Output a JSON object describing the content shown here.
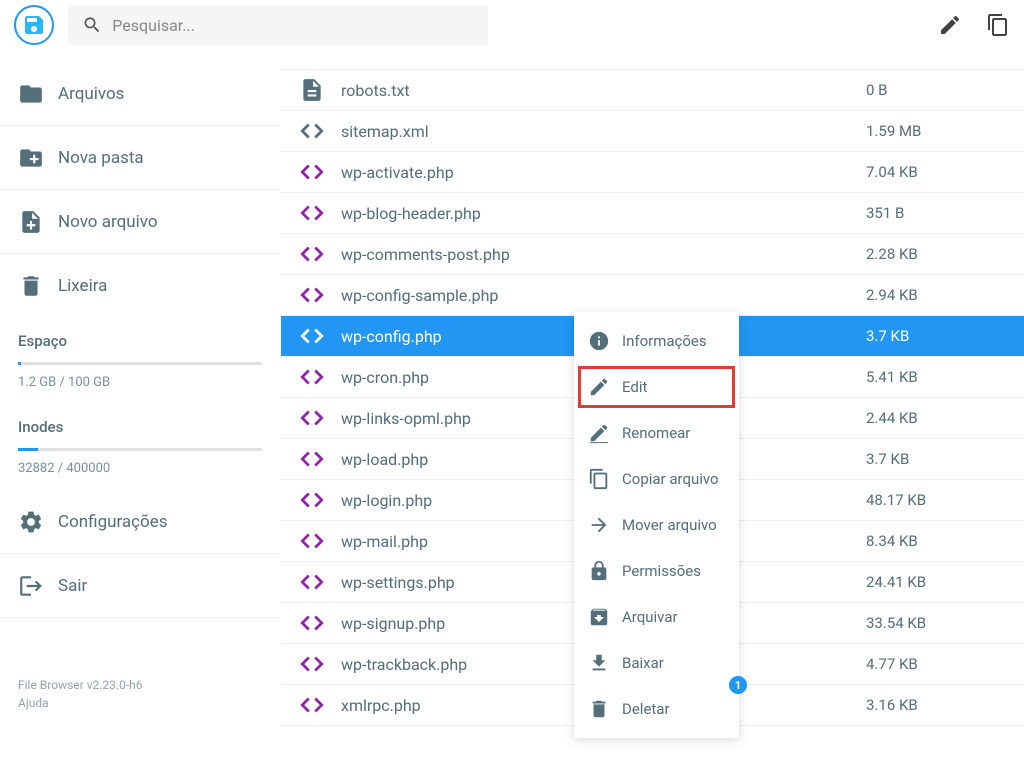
{
  "header": {
    "search_placeholder": "Pesquisar..."
  },
  "sidebar": {
    "nav": [
      {
        "label": "Arquivos",
        "icon": "folder"
      },
      {
        "label": "Nova pasta",
        "icon": "create-folder"
      },
      {
        "label": "Novo arquivo",
        "icon": "note-add"
      },
      {
        "label": "Lixeira",
        "icon": "trash"
      }
    ],
    "meters": [
      {
        "label": "Espaço",
        "text": "1.2 GB / 100 GB",
        "fill_pct": 1.2
      },
      {
        "label": "Inodes",
        "text": "32882 / 400000",
        "fill_pct": 8
      }
    ],
    "bottom_nav": [
      {
        "label": "Configurações",
        "icon": "settings"
      },
      {
        "label": "Sair",
        "icon": "logout"
      }
    ],
    "version": "File Browser v2.23.0-h6",
    "help": "Ajuda"
  },
  "files": [
    {
      "name": "robots.txt",
      "size": "0 B",
      "icon": "doc",
      "selected": false
    },
    {
      "name": "sitemap.xml",
      "size": "1.59 MB",
      "icon": "code-gray",
      "selected": false
    },
    {
      "name": "wp-activate.php",
      "size": "7.04 KB",
      "icon": "code",
      "selected": false
    },
    {
      "name": "wp-blog-header.php",
      "size": "351 B",
      "icon": "code",
      "selected": false
    },
    {
      "name": "wp-comments-post.php",
      "size": "2.28 KB",
      "icon": "code",
      "selected": false
    },
    {
      "name": "wp-config-sample.php",
      "size": "2.94 KB",
      "icon": "code",
      "selected": false
    },
    {
      "name": "wp-config.php",
      "size": "3.7 KB",
      "icon": "code",
      "selected": true
    },
    {
      "name": "wp-cron.php",
      "size": "5.41 KB",
      "icon": "code",
      "selected": false
    },
    {
      "name": "wp-links-opml.php",
      "size": "2.44 KB",
      "icon": "code",
      "selected": false
    },
    {
      "name": "wp-load.php",
      "size": "3.7 KB",
      "icon": "code",
      "selected": false
    },
    {
      "name": "wp-login.php",
      "size": "48.17 KB",
      "icon": "code",
      "selected": false
    },
    {
      "name": "wp-mail.php",
      "size": "8.34 KB",
      "icon": "code",
      "selected": false
    },
    {
      "name": "wp-settings.php",
      "size": "24.41 KB",
      "icon": "code",
      "selected": false
    },
    {
      "name": "wp-signup.php",
      "size": "33.54 KB",
      "icon": "code",
      "selected": false
    },
    {
      "name": "wp-trackback.php",
      "size": "4.77 KB",
      "icon": "code",
      "selected": false
    },
    {
      "name": "xmlrpc.php",
      "size": "3.16 KB",
      "icon": "code",
      "selected": false
    }
  ],
  "context_menu": {
    "items": [
      {
        "label": "Informações",
        "icon": "info"
      },
      {
        "label": "Edit",
        "icon": "edit",
        "highlighted": true
      },
      {
        "label": "Renomear",
        "icon": "rename"
      },
      {
        "label": "Copiar arquivo",
        "icon": "copy"
      },
      {
        "label": "Mover arquivo",
        "icon": "move"
      },
      {
        "label": "Permissões",
        "icon": "lock"
      },
      {
        "label": "Arquivar",
        "icon": "archive"
      },
      {
        "label": "Baixar",
        "icon": "download",
        "badge": "1"
      },
      {
        "label": "Deletar",
        "icon": "trash"
      }
    ]
  }
}
